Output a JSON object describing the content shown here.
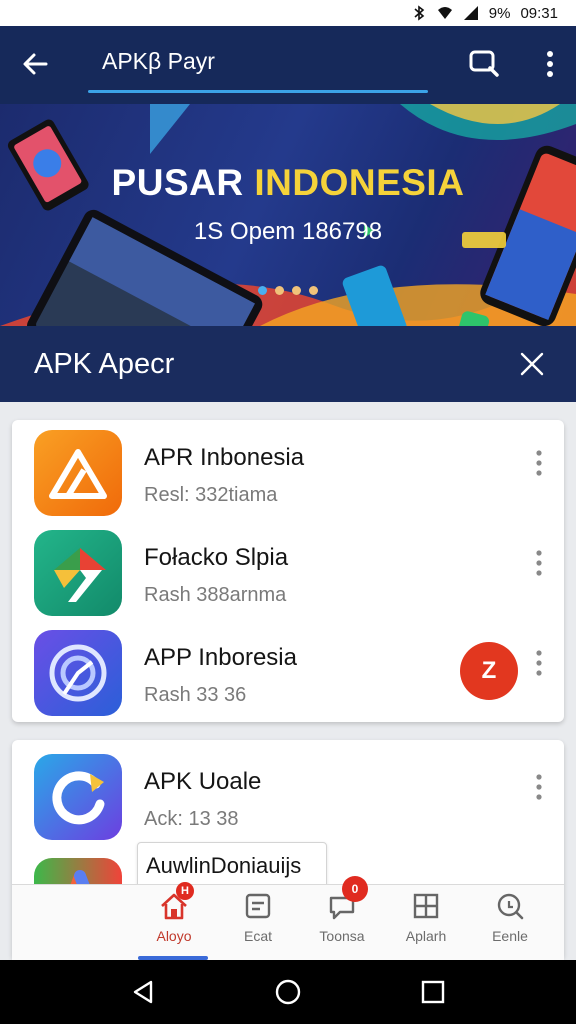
{
  "status_bar": {
    "battery": "9%",
    "time": "09:31",
    "icons": [
      "bluetooth-icon",
      "wifi-icon",
      "signal-icon"
    ]
  },
  "app_bar": {
    "title": "APKβ Payr",
    "icons": [
      "back-arrow-icon",
      "search-icon",
      "more-vertical-icon"
    ]
  },
  "banner": {
    "title_white": "PUSAR ",
    "title_highlight": "INDONESIA",
    "subtitle": "1S Opem 186798",
    "highlight_color": "#f5d23a",
    "pager_dots": 4,
    "active_dot": 0
  },
  "section": {
    "title": "APK Apecr",
    "icon": "close-icon"
  },
  "list_card_1": [
    {
      "name": "APR Inbonesia",
      "sub": "Resl: 332tiama",
      "icon": "triangle-app-icon",
      "color": "#f58a12"
    },
    {
      "name": "Fołacko Slpia",
      "sub": "Rash 388arnma",
      "icon": "arrow-app-icon",
      "color": "#19a67c"
    },
    {
      "name": "APP Inboresia",
      "sub": "Rash 33 36",
      "icon": "spiral-app-icon",
      "color": "#4e3fc9",
      "badge": "Z"
    }
  ],
  "list_card_2": [
    {
      "name": "APK Uoale",
      "sub": "Ack: 13 38",
      "icon": "refresh-app-icon",
      "color": "#5a4fe0"
    }
  ],
  "tooltip": {
    "text": "AuwlinDoniauijs"
  },
  "bottom_nav": [
    {
      "label": "Aloyo",
      "icon": "home-icon",
      "badge": "H",
      "active": true
    },
    {
      "label": "Ecat",
      "icon": "list-icon"
    },
    {
      "label": "Toonsa",
      "icon": "chat-icon",
      "badge": "0"
    },
    {
      "label": "Aplarh",
      "icon": "grid-icon"
    },
    {
      "label": "Eenle",
      "icon": "search-icon"
    }
  ],
  "system_nav": [
    "back-icon",
    "home-circle-icon",
    "recents-icon"
  ],
  "colors": {
    "app_bar": "#16295a",
    "accent_blue": "#3ba3e8",
    "badge_red": "#e2371f"
  }
}
